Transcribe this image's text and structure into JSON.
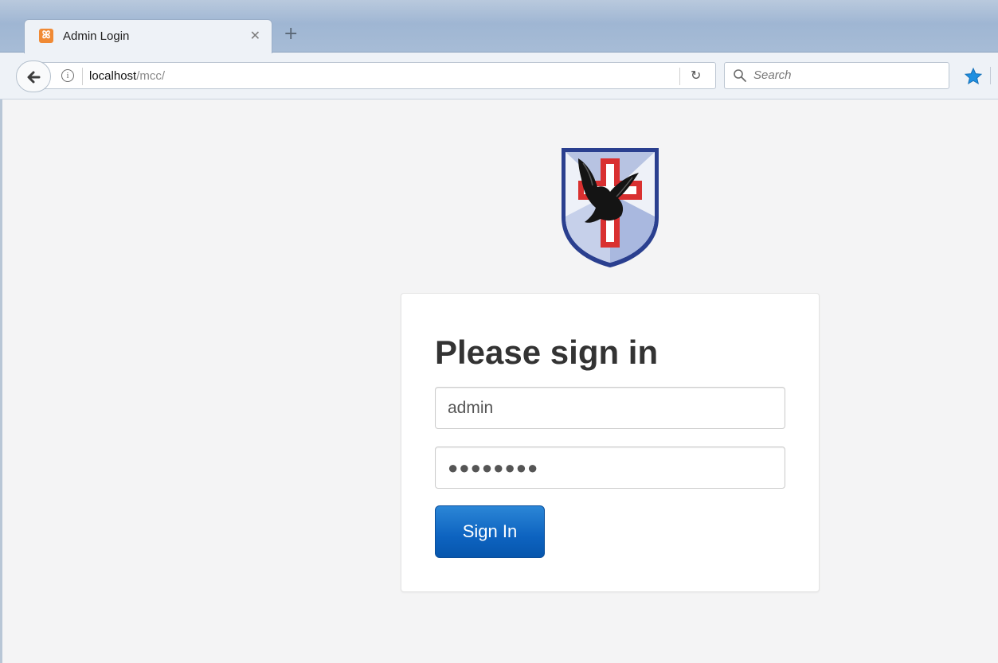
{
  "browser": {
    "tab": {
      "title": "Admin Login",
      "favicon_color": "#f08a35"
    },
    "address": {
      "host": "localhost",
      "path": "/mcc/"
    },
    "search": {
      "placeholder": "Search"
    }
  },
  "login": {
    "heading": "Please sign in",
    "username_value": "admin",
    "password_mask": "●●●●●●●●",
    "submit_label": "Sign In"
  },
  "colors": {
    "button_primary": "#0d63c0",
    "page_background": "#f4f4f5",
    "card_background": "#ffffff",
    "logo_cross": "#d93030",
    "logo_shield_border": "#2a3f8f"
  },
  "icons": {
    "back": "back-arrow-icon",
    "info": "info-icon",
    "reload": "reload-icon",
    "search": "search-icon",
    "bookmark": "star-icon",
    "close_tab": "close-icon",
    "new_tab": "plus-icon"
  }
}
